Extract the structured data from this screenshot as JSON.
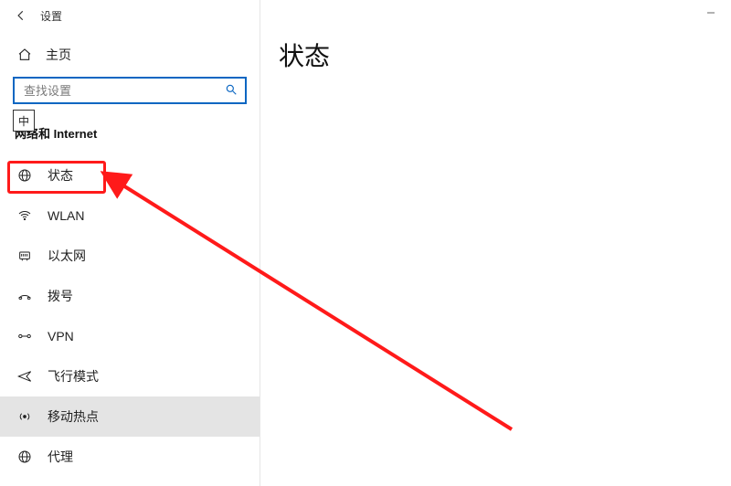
{
  "titlebar": {
    "title": "设置"
  },
  "home": {
    "label": "主页"
  },
  "search": {
    "placeholder": "查找设置"
  },
  "ime": {
    "badge": "中"
  },
  "section": {
    "title_prefix": "网络和",
    "title_suffix": " Internet"
  },
  "nav": [
    {
      "icon": "globe",
      "label": "状态",
      "selected": false
    },
    {
      "icon": "wifi",
      "label": "WLAN",
      "selected": false
    },
    {
      "icon": "ethernet",
      "label": "以太网",
      "selected": false
    },
    {
      "icon": "dialup",
      "label": "拨号",
      "selected": false
    },
    {
      "icon": "vpn",
      "label": "VPN",
      "selected": false
    },
    {
      "icon": "airplane",
      "label": "飞行模式",
      "selected": false
    },
    {
      "icon": "hotspot",
      "label": "移动热点",
      "selected": true
    },
    {
      "icon": "proxy",
      "label": "代理",
      "selected": false
    }
  ],
  "content": {
    "heading": "状态"
  },
  "annotation": {
    "highlight_color": "#ff1a1a"
  }
}
